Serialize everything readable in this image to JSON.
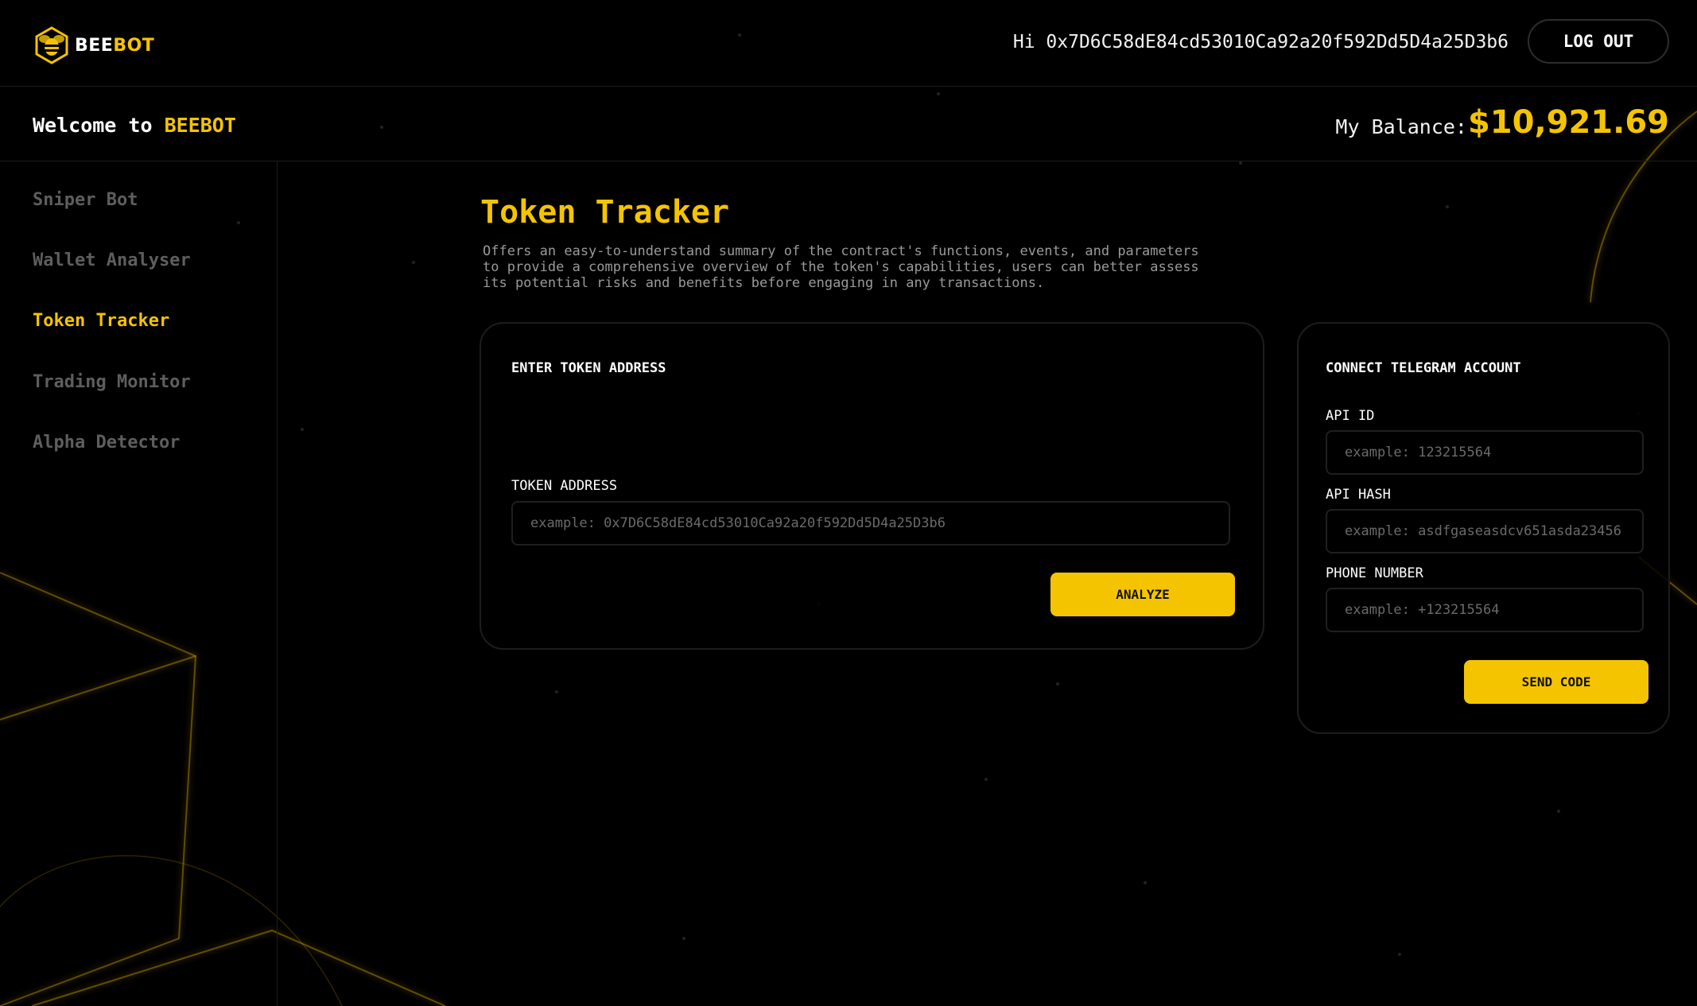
{
  "brand": {
    "logo_icon": "bee-hex-icon",
    "name_part1": "BEE",
    "name_part2": "BOT",
    "accent_color": "#f5c400"
  },
  "header": {
    "greeting": "Hi 0x7D6C58dE84cd53010Ca92a20f592Dd5D4a25D3b6",
    "logout_label": "LOG OUT"
  },
  "welcome": {
    "prefix": "Welcome to ",
    "brand": "BEEBOT"
  },
  "balance": {
    "label": "My Balance:",
    "value": "$10,921.69"
  },
  "sidebar": {
    "items": [
      {
        "label": "Sniper Bot",
        "active": false
      },
      {
        "label": "Wallet Analyser",
        "active": false
      },
      {
        "label": "Token Tracker",
        "active": true
      },
      {
        "label": "Trading Monitor",
        "active": false
      },
      {
        "label": "Alpha Detector",
        "active": false
      }
    ]
  },
  "main": {
    "title": "Token Tracker",
    "description": "Offers an easy-to-understand summary of the contract's functions, events, and parameters to provide a comprehensive overview of the token's capabilities, users can better assess its potential risks and benefits before engaging in any transactions."
  },
  "token_card": {
    "heading": "ENTER TOKEN ADDRESS",
    "field_label": "TOKEN ADDRESS",
    "field_value": "",
    "field_placeholder": "example: 0x7D6C58dE84cd53010Ca92a20f592Dd5D4a25D3b6",
    "button_label": "ANALYZE"
  },
  "telegram_card": {
    "heading": "CONNECT TELEGRAM ACCOUNT",
    "api_id_label": "API ID",
    "api_id_value": "",
    "api_id_placeholder": "example: 123215564",
    "api_hash_label": "API HASH",
    "api_hash_value": "",
    "api_hash_placeholder": "example: asdfgaseasdcv651asda23456",
    "phone_label": "PHONE NUMBER",
    "phone_value": "",
    "phone_placeholder": "example: +123215564",
    "button_label": "SEND CODE"
  }
}
